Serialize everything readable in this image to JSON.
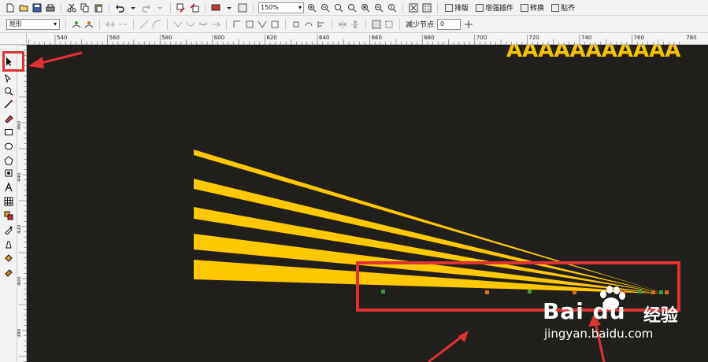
{
  "toolbar": {
    "zoom_value": "150%",
    "layout_label": "排版",
    "plugin_label": "增强插件",
    "convert_label": "转换",
    "align_label": "贴齐"
  },
  "property_bar": {
    "object_type": "矩形",
    "reduce_nodes_label": "减少节点",
    "reduce_nodes_value": "0"
  },
  "ruler_top": {
    "ticks": [
      "540",
      "560",
      "580",
      "600",
      "620",
      "640",
      "660",
      "680",
      "700",
      "720",
      "740",
      "760",
      "780"
    ]
  },
  "ruler_left": {
    "ticks": [
      "460",
      "440",
      "420",
      "400",
      "380"
    ]
  },
  "canvas": {
    "background_color": "#211f1c",
    "shape_color": "#ffc800",
    "banner_text": "AAAAAAAAAAA"
  },
  "annotations": {
    "color": "#e03232"
  },
  "watermark": {
    "logo_text": "Bai du",
    "brand_cn": "经验",
    "url": "jingyan.baidu.com"
  }
}
